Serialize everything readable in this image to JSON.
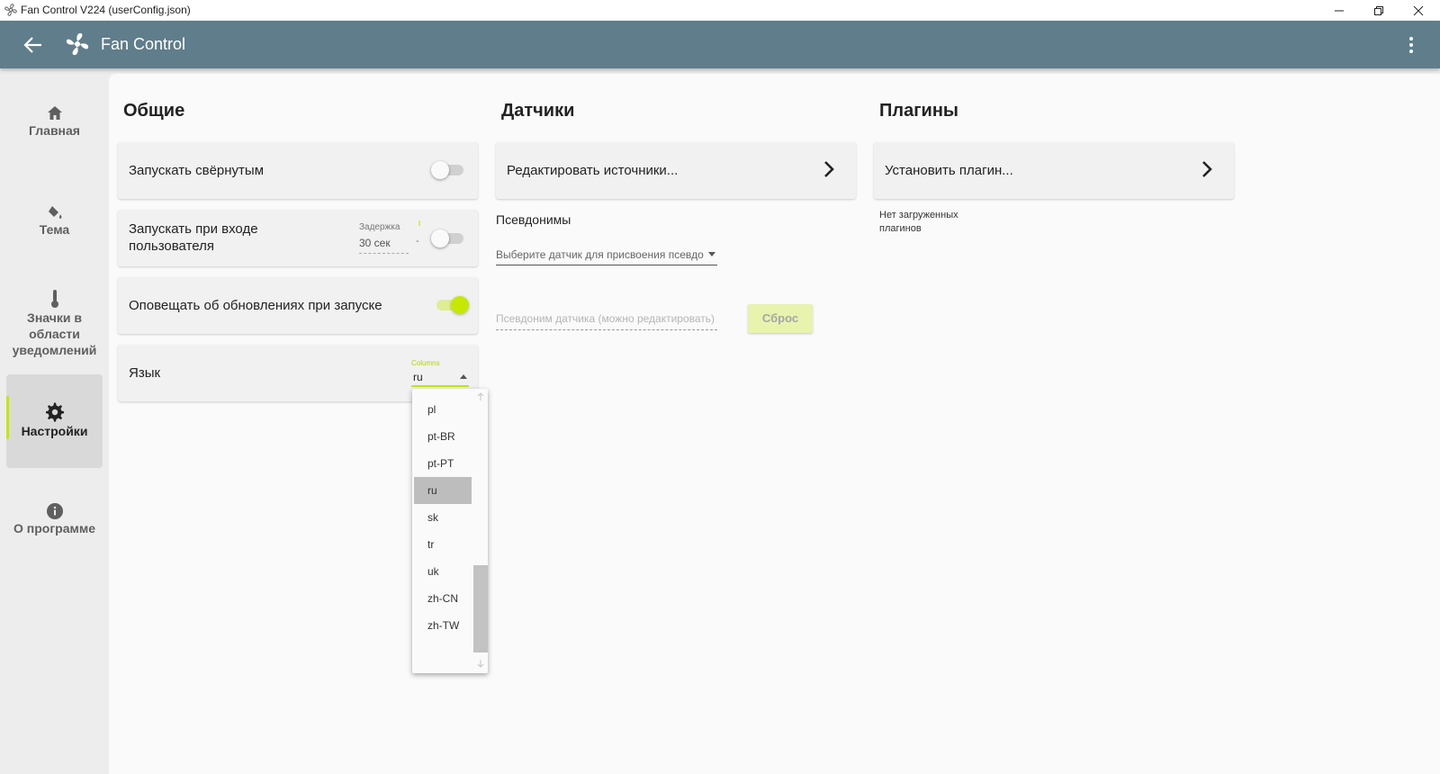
{
  "window": {
    "title": "Fan Control V224 (userConfig.json)"
  },
  "appbar": {
    "title": "Fan Control"
  },
  "sidebar": {
    "items": [
      {
        "label": "Главная",
        "icon": "home-icon"
      },
      {
        "label": "Тема",
        "icon": "paint-bucket-icon"
      },
      {
        "label": "Значки в области уведомлений",
        "icon": "thermometer-icon"
      },
      {
        "label": "Настройки",
        "icon": "gear-icon",
        "active": true
      },
      {
        "label": "О программе",
        "icon": "info-icon"
      }
    ]
  },
  "general": {
    "title": "Общие",
    "start_minimized": {
      "label": "Запускать свёрнутым",
      "enabled": false
    },
    "start_with_windows": {
      "label": "Запускать при входе пользователя",
      "delay_label": "Задержка",
      "delay_value": "30 сек",
      "enabled": false
    },
    "check_updates": {
      "label": "Оповещать об обновлениях при запуске",
      "enabled": true
    },
    "language": {
      "label": "Язык",
      "field_label": "Columns",
      "value": "ru"
    }
  },
  "language_dropdown": {
    "options": [
      "pl",
      "pt-BR",
      "pt-PT",
      "ru",
      "sk",
      "tr",
      "uk",
      "zh-CN",
      "zh-TW"
    ],
    "selected": "ru"
  },
  "sensors": {
    "title": "Датчики",
    "edit_sources": "Редактировать источники...",
    "aliases_label": "Псевдонимы",
    "sensor_select_placeholder": "Выберите датчик для присвоения псевдо",
    "alias_input_placeholder": "Псевдоним датчика (можно редактировать)",
    "reset_button": "Сброс"
  },
  "plugins": {
    "title": "Плагины",
    "install": "Установить плагин...",
    "none_loaded_line1": "Нет загруженных",
    "none_loaded_line2": "плагинов"
  },
  "colors": {
    "accent": "#c6e800",
    "appbar": "#607d8b",
    "selected_option": "#bdbdbd"
  }
}
